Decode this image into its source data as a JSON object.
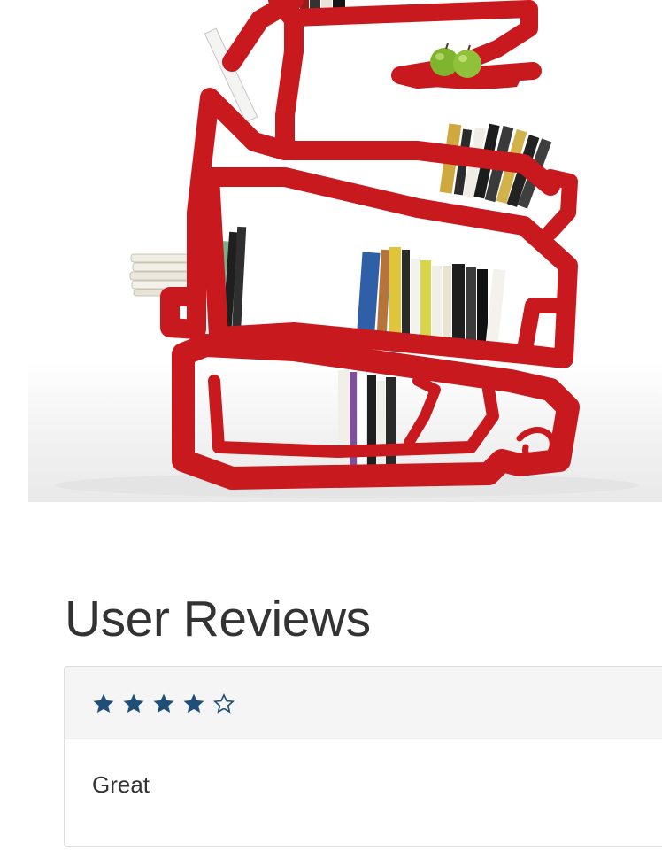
{
  "product": {
    "image_description_icon": "red-bookshelf-image"
  },
  "reviews": {
    "title": "User Reviews",
    "items": [
      {
        "rating": 4,
        "max_rating": 5,
        "text": "Great"
      }
    ]
  },
  "colors": {
    "star_fill": "#1f4e79",
    "shelf_red": "#c8191e",
    "panel_heading_bg": "#f5f5f5",
    "border": "#dddddd",
    "text": "#333333"
  }
}
